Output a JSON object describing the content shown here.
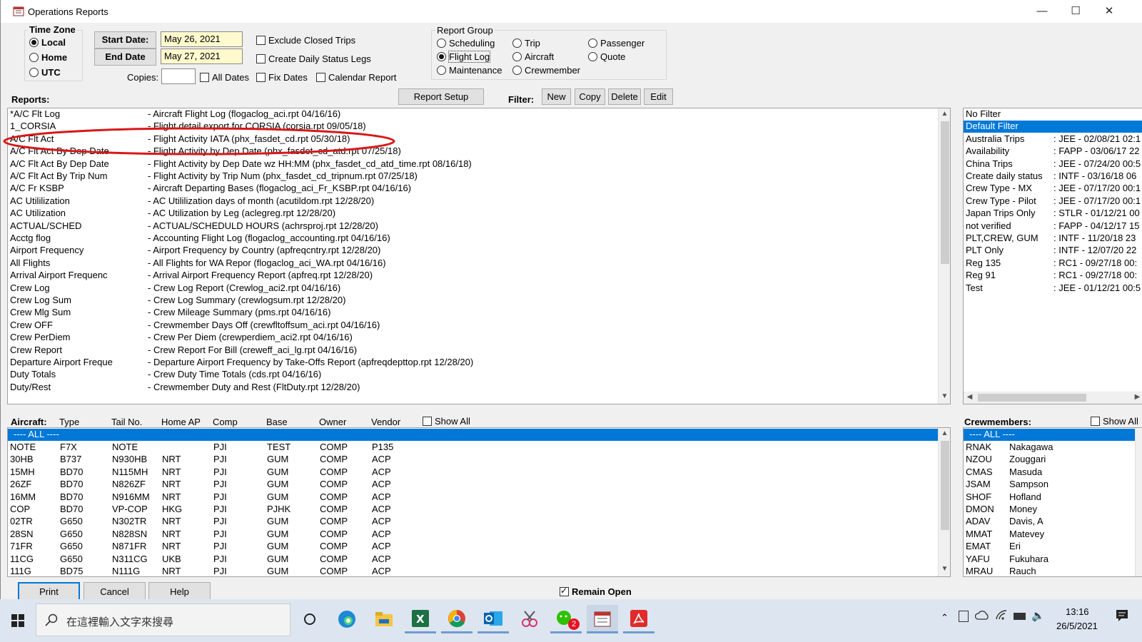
{
  "window": {
    "title": "Operations Reports"
  },
  "time_zone": {
    "title": "Time Zone",
    "options": [
      "Local",
      "Home",
      "UTC"
    ],
    "selected": "Local"
  },
  "dates": {
    "start_label": "Start Date:",
    "start_value": "May 26, 2021",
    "end_label": "End Date",
    "end_value": "May 27, 2021",
    "copies_label": "Copies:",
    "copies_value": ""
  },
  "checkboxes": {
    "exclude_closed": "Exclude Closed Trips",
    "daily_status": "Create Daily Status Legs",
    "all_dates": "All Dates",
    "fix_dates": "Fix Dates",
    "calendar_report": "Calendar Report",
    "remain_open": "Remain Open"
  },
  "report_group": {
    "title": "Report Group",
    "options": [
      "Scheduling",
      "Trip",
      "Passenger",
      "Flight Log",
      "Aircraft",
      "Quote",
      "Maintenance",
      "Crewmember"
    ],
    "selected": "Flight Log"
  },
  "toolbar": {
    "reports_label": "Reports:",
    "report_setup": "Report Setup",
    "filter_label": "Filter:",
    "new": "New",
    "copy": "Copy",
    "delete": "Delete",
    "edit": "Edit"
  },
  "reports": [
    {
      "name": "*A/C Flt Log",
      "desc": "- Aircraft Flight Log (flogaclog_aci.rpt 04/16/16)"
    },
    {
      "name": "1_CORSIA",
      "desc": "- Flight detail export for CORSIA (corsia.rpt 09/05/18)"
    },
    {
      "name": "A/C Flt Act",
      "desc": "- Flight Activity IATA (phx_fasdet_cd.rpt 05/30/18)"
    },
    {
      "name": "A/C Flt Act By Dep Date",
      "desc": "- Flight Activity by Dep Date (phx_fasdet_cd_atd.rpt 07/25/18)"
    },
    {
      "name": "A/C Flt Act By Dep Date",
      "desc": "- Flight Activity by Dep Date wz HH:MM (phx_fasdet_cd_atd_time.rpt 08/16/18)"
    },
    {
      "name": "A/C Flt Act By Trip Num",
      "desc": "- Flight Activity by Trip Num (phx_fasdet_cd_tripnum.rpt 07/25/18)"
    },
    {
      "name": "A/C Fr KSBP",
      "desc": "- Aircraft Departing Bases (flogaclog_aci_Fr_KSBP.rpt 04/16/16)"
    },
    {
      "name": "AC Utililization",
      "desc": "- AC Utililization days of month (acutildom.rpt 12/28/20)"
    },
    {
      "name": "AC Utilization",
      "desc": "- AC Utilization by Leg (aclegreg.rpt 12/28/20)"
    },
    {
      "name": "ACTUAL/SCHED",
      "desc": "- ACTUAL/SCHEDULD HOURS (achrsproj.rpt 12/28/20)"
    },
    {
      "name": "Acctg flog",
      "desc": "- Accounting Flight Log (flogaclog_accounting.rpt 04/16/16)"
    },
    {
      "name": "Airport Frequency",
      "desc": "- Airport Frequency by Country (apfreqcntry.rpt 12/28/20)"
    },
    {
      "name": "All Flights",
      "desc": "- All Flights for WA Repor (flogaclog_aci_WA.rpt 04/16/16)"
    },
    {
      "name": "Arrival Airport Frequenc",
      "desc": "- Arrival Airport Frequency Report (apfreq.rpt 12/28/20)"
    },
    {
      "name": "Crew Log",
      "desc": "- Crew Log Report (Crewlog_aci2.rpt 04/16/16)"
    },
    {
      "name": "Crew Log Sum",
      "desc": "- Crew Log Summary (crewlogsum.rpt 12/28/20)"
    },
    {
      "name": "Crew Mlg Sum",
      "desc": "- Crew Mileage Summary (pms.rpt 04/16/16)"
    },
    {
      "name": "Crew OFF",
      "desc": "- Crewmember Days Off (crewfltoffsum_aci.rpt 04/16/16)"
    },
    {
      "name": "Crew PerDiem",
      "desc": "- Crew Per Diem (crewperdiem_aci2.rpt 04/16/16)"
    },
    {
      "name": "Crew Report",
      "desc": "- Crew Report For Bill (creweff_aci_lg.rpt 04/16/16)"
    },
    {
      "name": "Departure Airport Freque",
      "desc": "- Departure Airport Frequency by Take-Offs Report (apfreqdepttop.rpt 12/28/20)"
    },
    {
      "name": "Duty Totals",
      "desc": "- Crew Duty Time Totals (cds.rpt 04/16/16)"
    },
    {
      "name": "Duty/Rest",
      "desc": "- Crewmember Duty and Rest (FltDuty.rpt 12/28/20)"
    }
  ],
  "filters": [
    {
      "name": "No Filter",
      "info": ""
    },
    {
      "name": "Default Filter",
      "info": ""
    },
    {
      "name": "Australia Trips",
      "info": ": JEE - 02/08/21 02:1"
    },
    {
      "name": "Availability",
      "info": ": FAPP - 03/06/17 22"
    },
    {
      "name": "China Trips",
      "info": ": JEE - 07/24/20 00:5"
    },
    {
      "name": "Create daily status",
      "info": ": INTF - 03/16/18 06"
    },
    {
      "name": "Crew Type - MX",
      "info": ": JEE - 07/17/20 00:1"
    },
    {
      "name": "Crew Type - Pilot",
      "info": ": JEE - 07/17/20 00:1"
    },
    {
      "name": "Japan Trips Only",
      "info": ": STLR - 01/12/21 00"
    },
    {
      "name": "not verified",
      "info": ": FAPP - 04/12/17 15"
    },
    {
      "name": "PLT,CREW, GUM",
      "info": ": INTF - 11/20/18 23"
    },
    {
      "name": "PLT Only",
      "info": ": INTF - 12/07/20 22"
    },
    {
      "name": "Reg 135",
      "info": ": RC1 - 09/27/18 00:"
    },
    {
      "name": "Reg 91",
      "info": ": RC1 - 09/27/18 00:"
    },
    {
      "name": "Test",
      "info": ": JEE - 01/12/21 00:5"
    }
  ],
  "aircraft": {
    "label": "Aircraft:",
    "show_all": "Show All",
    "headers": [
      "Type",
      "Tail No.",
      "Home AP",
      "Comp",
      "Base",
      "Owner",
      "Vendor"
    ],
    "all_row": "---- ALL ----",
    "rows": [
      [
        "NOTE",
        "F7X",
        "NOTE",
        "",
        "PJI",
        "TEST",
        "COMP",
        "P135"
      ],
      [
        "30HB",
        "B737",
        "N930HB",
        "NRT",
        "PJI",
        "GUM",
        "COMP",
        "ACP"
      ],
      [
        "15MH",
        "BD70",
        "N115MH",
        "NRT",
        "PJI",
        "GUM",
        "COMP",
        "ACP"
      ],
      [
        "26ZF",
        "BD70",
        "N826ZF",
        "NRT",
        "PJI",
        "GUM",
        "COMP",
        "ACP"
      ],
      [
        "16MM",
        "BD70",
        "N916MM",
        "NRT",
        "PJI",
        "GUM",
        "COMP",
        "ACP"
      ],
      [
        "COP",
        "BD70",
        "VP-COP",
        "HKG",
        "PJI",
        "PJHK",
        "COMP",
        "ACP"
      ],
      [
        "02TR",
        "G650",
        "N302TR",
        "NRT",
        "PJI",
        "GUM",
        "COMP",
        "ACP"
      ],
      [
        "28SN",
        "G650",
        "N828SN",
        "NRT",
        "PJI",
        "GUM",
        "COMP",
        "ACP"
      ],
      [
        "71FR",
        "G650",
        "N871FR",
        "NRT",
        "PJI",
        "GUM",
        "COMP",
        "ACP"
      ],
      [
        "11CG",
        "G650",
        "N311CG",
        "UKB",
        "PJI",
        "GUM",
        "COMP",
        "ACP"
      ],
      [
        "111G",
        "BD75",
        "N111G",
        "NRT",
        "PJI",
        "GUM",
        "COMP",
        "ACP"
      ]
    ]
  },
  "crew": {
    "label": "Crewmembers:",
    "show_all": "Show All",
    "all_row": "---- ALL ----",
    "rows": [
      [
        "RNAK",
        "Nakagawa"
      ],
      [
        "NZOU",
        "Zouggari"
      ],
      [
        "CMAS",
        "Masuda"
      ],
      [
        "JSAM",
        "Sampson"
      ],
      [
        "SHOF",
        "Hofland"
      ],
      [
        "DMON",
        "Money"
      ],
      [
        "ADAV",
        "Davis, A"
      ],
      [
        "MMAT",
        "Matevey"
      ],
      [
        "EMAT",
        "Eri"
      ],
      [
        "YAFU",
        "Fukuhara"
      ],
      [
        "MRAU",
        "Rauch"
      ]
    ]
  },
  "bottom_buttons": {
    "print": "Print",
    "cancel": "Cancel",
    "help": "Help"
  },
  "taskbar": {
    "search_placeholder": "在這裡輸入文字來搜尋",
    "time": "13:16",
    "date": "26/5/2021",
    "badge_count": "2",
    "apps": [
      "task-view-icon",
      "edge-icon",
      "file-explorer-icon",
      "excel-icon",
      "chrome-icon",
      "outlook-icon",
      "snipping-icon",
      "wechat-icon",
      "fos-app-icon",
      "acrobat-icon"
    ]
  }
}
